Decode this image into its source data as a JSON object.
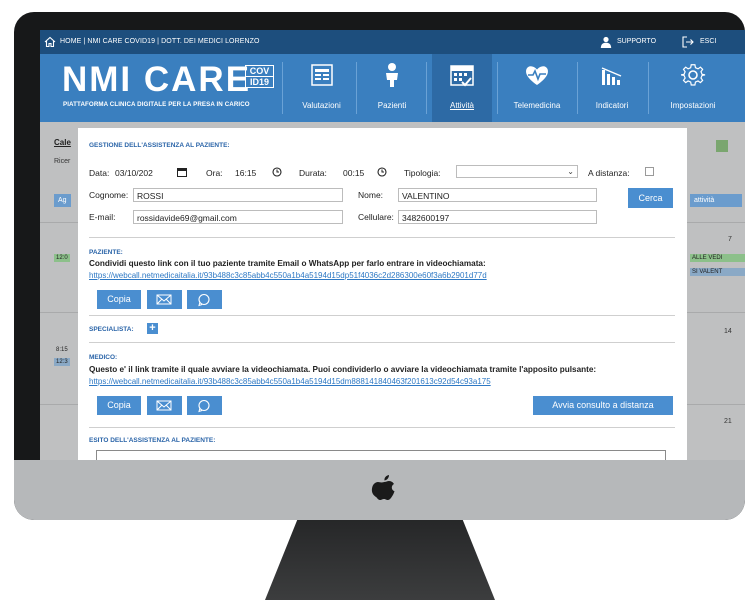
{
  "topbar": {
    "breadcrumb": "HOME | NMI CARE COVID19 | DOTT. DEI MEDICI LORENZO",
    "support": "SUPPORTO",
    "exit": "ESCI"
  },
  "brand": {
    "logo": "NMI CARE",
    "badge_line1": "COV",
    "badge_line2": "ID19",
    "tagline": "PIATTAFORMA CLINICA DIGITALE PER LA PRESA IN CARICO"
  },
  "nav": [
    {
      "label": "Valutazioni",
      "icon": "clipboard-icon"
    },
    {
      "label": "Pazienti",
      "icon": "person-icon"
    },
    {
      "label": "Attività",
      "icon": "calendar-icon",
      "selected": true
    },
    {
      "label": "Telemedicina",
      "icon": "heart-pulse-icon"
    },
    {
      "label": "Indicatori",
      "icon": "bar-chart-icon"
    },
    {
      "label": "Impostazioni",
      "icon": "gear-icon"
    }
  ],
  "background": {
    "title": "Cale",
    "search": "Ricer",
    "add_button": "Ag",
    "activity_button": "attività",
    "times": [
      "12:0",
      "8:15",
      "12:3"
    ],
    "days": [
      "7",
      "14",
      "21"
    ],
    "chip_top": "ALLE VEDI",
    "chip_bottom": "SI VALENT"
  },
  "form": {
    "heading": "GESTIONE DELL'ASSISTENZA AL PAZIENTE:",
    "data_label": "Data:",
    "data_value": "03/10/202",
    "ora_label": "Ora:",
    "ora_value": "16:15",
    "durata_label": "Durata:",
    "durata_value": "00:15",
    "tipologia_label": "Tipologia:",
    "distanza_label": "A distanza:",
    "cognome_label": "Cognome:",
    "cognome_value": "ROSSI",
    "nome_label": "Nome:",
    "nome_value": "VALENTINO",
    "email_label": "E-mail:",
    "email_value": "rossidavide69@gmail.com",
    "cellulare_label": "Cellulare:",
    "cellulare_value": "3482600197",
    "search_button": "Cerca"
  },
  "patient": {
    "heading": "PAZIENTE:",
    "text": "Condividi questo link con il tuo paziente tramite Email o WhatsApp per farlo entrare in videochiamata:",
    "link": "https://webcall.netmedicaitalia.it/93b488c3c85abb4c550a1b4a5194d15dp51f4036c2d286300e60f3a6b2901d77d",
    "copy_button": "Copia"
  },
  "specialist": {
    "heading": "SPECIALISTA:"
  },
  "doctor": {
    "heading": "MEDICO:",
    "text": "Questo e' il link tramite il quale avviare la videochiamata. Puoi condividerlo o avviare la videochiamata tramite l'apposito pulsante:",
    "link": "https://webcall.netmedicaitalia.it/93b488c3c85abb4c550a1b4a5194d15dm888141840463f201613c92d54c93a175",
    "copy_button": "Copia",
    "start_button": "Avvia consulto a distanza"
  },
  "outcome": {
    "heading": "ESITO DELL'ASSISTENZA AL PAZIENTE:"
  },
  "colors": {
    "topbar": "#1d4e7d",
    "header": "#3a7fbf",
    "button": "#4a8ed0",
    "link": "#2d78c4",
    "section_heading": "#2a64a8"
  }
}
